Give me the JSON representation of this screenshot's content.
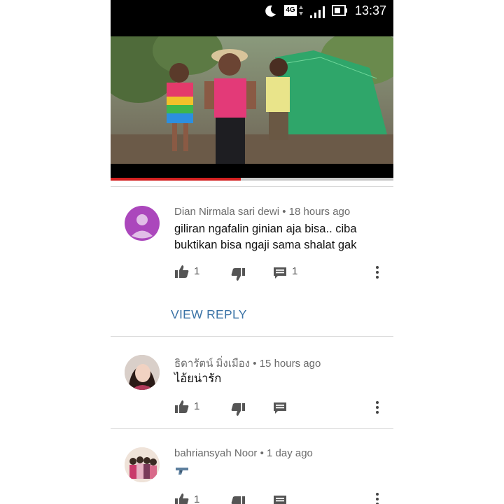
{
  "status_bar": {
    "network": "4G",
    "time": "13:37"
  },
  "video": {
    "progress": 0.46,
    "progress_color": "#d32020"
  },
  "comments": [
    {
      "author": "Dian Nirmala sari dewi",
      "separator": "•",
      "time": "18 hours ago",
      "text": "giliran ngafalin ginian aja bisa.. ciba buktikan bisa ngaji sama shalat gak",
      "likes": "1",
      "replies": "1",
      "avatar": "default-person-avatar",
      "avatar_color": "#ab47bc"
    },
    {
      "author": "ธิดารัตน์ มิ่งเมือง",
      "separator": "•",
      "time": "15 hours ago",
      "text": "ไอ้ยน่ารัก",
      "likes": "1",
      "replies": "",
      "avatar": "user-photo-avatar"
    },
    {
      "author": "bahriansyah Noor",
      "separator": "•",
      "time": "1 day ago",
      "text": "",
      "emoji": "pistol",
      "likes": "1",
      "replies": "",
      "avatar": "group-photo-avatar"
    }
  ],
  "view_reply": {
    "label": "VIEW REPLY",
    "color": "#3b73a6"
  }
}
